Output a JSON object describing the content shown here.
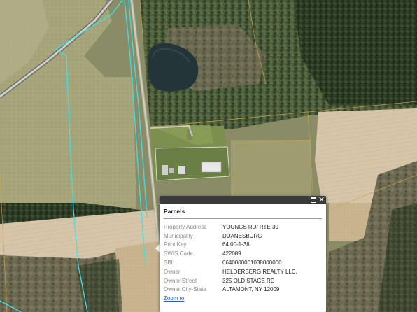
{
  "map": {
    "parcel_line_color": "#3fe0e8",
    "road_color": "#c8c8c0",
    "boundary_color": "#c9a64c"
  },
  "popup": {
    "title": "Parcels",
    "maximize_icon": "maximize-icon",
    "close_icon": "close-icon",
    "titlebar_color": "#3a3a3a",
    "rows": [
      {
        "key": "Property Address",
        "value": "YOUNGS RD/ RTE 30"
      },
      {
        "key": "Municipality",
        "value": "DUANESBURG"
      },
      {
        "key": "Print Key",
        "value": "64.00-1-38"
      },
      {
        "key": "SWIS Code",
        "value": "422089"
      },
      {
        "key": "SBL",
        "value": "0640000001038000000"
      },
      {
        "key": "Owner",
        "value": "HELDERBERG REALTY LLC,"
      },
      {
        "key": "Owner Street",
        "value": "325 OLD STAGE RD"
      },
      {
        "key": "Owner City-State",
        "value": "ALTAMONT, NY 12009"
      }
    ],
    "zoom_link": "Zoom to"
  }
}
